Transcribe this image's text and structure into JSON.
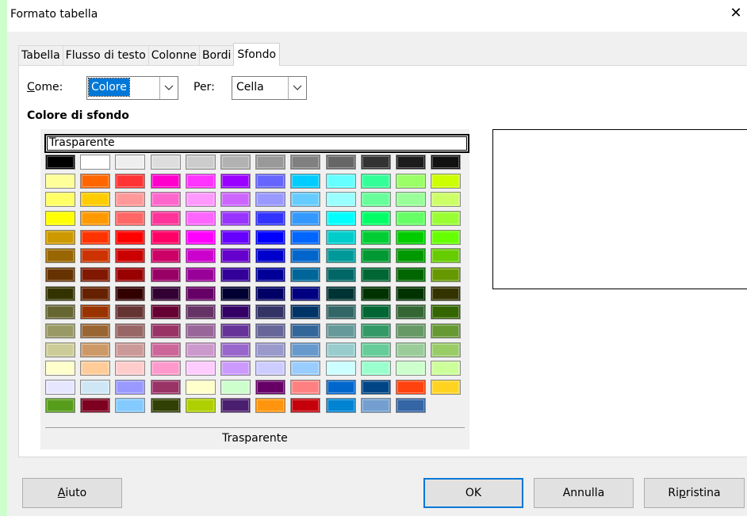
{
  "window": {
    "title": "Formato tabella",
    "close_glyph": "✕"
  },
  "tabs": [
    {
      "label": "Tabella"
    },
    {
      "label": "Flusso di testo"
    },
    {
      "label": "Colonne"
    },
    {
      "label": "Bordi"
    },
    {
      "label": "Sfondo",
      "active": true
    }
  ],
  "background": {
    "as_label": "Come:",
    "as_value": "Colore",
    "for_label": "Per:",
    "for_value": "Cella",
    "section_title": "Colore di sfondo",
    "transparent_field": "Trasparente",
    "selected_name": "Trasparente"
  },
  "palette_colors": [
    [
      "#000000",
      "#ffffff",
      "#eeeeee",
      "#dddddd",
      "#cccccc",
      "#b2b2b2",
      "#999999",
      "#808080",
      "#666666",
      "#333333",
      "#1c1c1c",
      "#111111"
    ],
    [
      "#ffff99",
      "#ff6600",
      "#ff3333",
      "#ff00cc",
      "#ff33ff",
      "#9900ff",
      "#6666ff",
      "#00ccff",
      "#66ffff",
      "#33ff99",
      "#99ff66",
      "#ccff00"
    ],
    [
      "#ffff66",
      "#ffcc00",
      "#ff9999",
      "#ff66cc",
      "#ff99ff",
      "#cc66ff",
      "#9999ff",
      "#66ccff",
      "#99ffff",
      "#66ff99",
      "#99ff99",
      "#ccff66"
    ],
    [
      "#ffff00",
      "#ff9900",
      "#ff6666",
      "#ff3399",
      "#ff66ff",
      "#9933ff",
      "#3333ff",
      "#3399ff",
      "#00ffff",
      "#00ff66",
      "#66ff66",
      "#99ff33"
    ],
    [
      "#cc9900",
      "#ff3300",
      "#ff0000",
      "#ff0066",
      "#ff00ff",
      "#6600ff",
      "#0000ff",
      "#0066ff",
      "#00cccc",
      "#00cc33",
      "#00cc00",
      "#66ff00"
    ],
    [
      "#996600",
      "#cc3300",
      "#cc0000",
      "#cc0066",
      "#cc00cc",
      "#6600cc",
      "#0000cc",
      "#0066cc",
      "#009999",
      "#009933",
      "#009900",
      "#66cc00"
    ],
    [
      "#663300",
      "#801900",
      "#990000",
      "#990066",
      "#990099",
      "#330099",
      "#000099",
      "#006699",
      "#006666",
      "#006633",
      "#006600",
      "#669900"
    ],
    [
      "#333300",
      "#662200",
      "#330000",
      "#330033",
      "#660066",
      "#000033",
      "#000066",
      "#000080",
      "#003333",
      "#003300",
      "#003300",
      "#333300"
    ],
    [
      "#666633",
      "#993300",
      "#663333",
      "#660033",
      "#663366",
      "#330066",
      "#333366",
      "#003366",
      "#336666",
      "#006633",
      "#336633",
      "#336600"
    ],
    [
      "#999966",
      "#996633",
      "#996666",
      "#993366",
      "#996699",
      "#663399",
      "#666699",
      "#336699",
      "#669999",
      "#339966",
      "#669966",
      "#669933"
    ],
    [
      "#cccc99",
      "#cc9966",
      "#cc9999",
      "#cc6699",
      "#cc99cc",
      "#9966cc",
      "#9999cc",
      "#6699cc",
      "#99cccc",
      "#66cc99",
      "#99cc99",
      "#99cc66"
    ],
    [
      "#ffffcc",
      "#ffcc99",
      "#ffcccc",
      "#ff99cc",
      "#ffccff",
      "#cc99ff",
      "#ccccff",
      "#99ccff",
      "#ccffff",
      "#99ffcc",
      "#ccffcc",
      "#ccff99"
    ],
    [
      "#e6e6ff",
      "#cfe7f5",
      "#9999ff",
      "#993366",
      "#ffffcc",
      "#ccffcc",
      "#660066",
      "#ff8080",
      "#0066cc",
      "#004586",
      "#ff420e",
      "#ffd320"
    ],
    [
      "#579d1c",
      "#7e0021",
      "#83caff",
      "#314004",
      "#aecf00",
      "#4b1f6f",
      "#ff950e",
      "#c5000b",
      "#0084d1",
      "#729fcf",
      "#3465a4"
    ]
  ],
  "buttons": {
    "help_pre": "",
    "help_ul": "A",
    "help_post": "iuto",
    "ok": "OK",
    "cancel": "Annulla",
    "reset_pre": "Ri",
    "reset_ul": "p",
    "reset_post": "ristina"
  },
  "icons": {
    "dropdown": "chevron-down-icon",
    "close": "close-icon"
  }
}
